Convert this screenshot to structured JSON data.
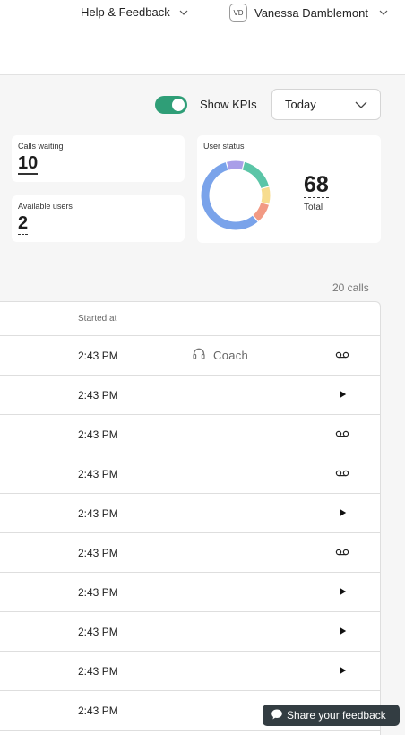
{
  "header": {
    "help_label": "Help & Feedback",
    "user_initials": "VD",
    "user_name": "Vanessa Damblemont"
  },
  "controls": {
    "show_kpis_label": "Show KPIs",
    "show_kpis_on": true,
    "date_range_value": "Today"
  },
  "kpis": {
    "calls_waiting": {
      "label": "Calls waiting",
      "value": "10"
    },
    "available_users": {
      "label": "Available users",
      "value": "2"
    },
    "user_status": {
      "label": "User status",
      "total_value": "68",
      "total_label": "Total",
      "segments": [
        {
          "color": "#5bc5a7",
          "share": 0.16
        },
        {
          "color": "#f7dc8f",
          "share": 0.08
        },
        {
          "color": "#f29a84",
          "share": 0.09
        },
        {
          "color": "#7aa3ea",
          "share": 0.54
        },
        {
          "color": "#a99ee8",
          "share": 0.08
        }
      ]
    }
  },
  "calls": {
    "count_label": "20 calls",
    "column_started": "Started at",
    "coach_label": "Coach",
    "rows": [
      {
        "time": "2:43 PM",
        "coach": true,
        "action": "voicemail-icon"
      },
      {
        "time": "2:43 PM",
        "coach": false,
        "action": "play-icon"
      },
      {
        "time": "2:43 PM",
        "coach": false,
        "action": "voicemail-icon"
      },
      {
        "time": "2:43 PM",
        "coach": false,
        "action": "voicemail-icon"
      },
      {
        "time": "2:43 PM",
        "coach": false,
        "action": "play-icon"
      },
      {
        "time": "2:43 PM",
        "coach": false,
        "action": "voicemail-icon"
      },
      {
        "time": "2:43 PM",
        "coach": false,
        "action": "play-icon"
      },
      {
        "time": "2:43 PM",
        "coach": false,
        "action": "play-icon"
      },
      {
        "time": "2:43 PM",
        "coach": false,
        "action": "play-icon"
      },
      {
        "time": "2:43 PM",
        "coach": false,
        "action": "none"
      }
    ]
  },
  "feedback": {
    "label": "Share your feedback"
  }
}
